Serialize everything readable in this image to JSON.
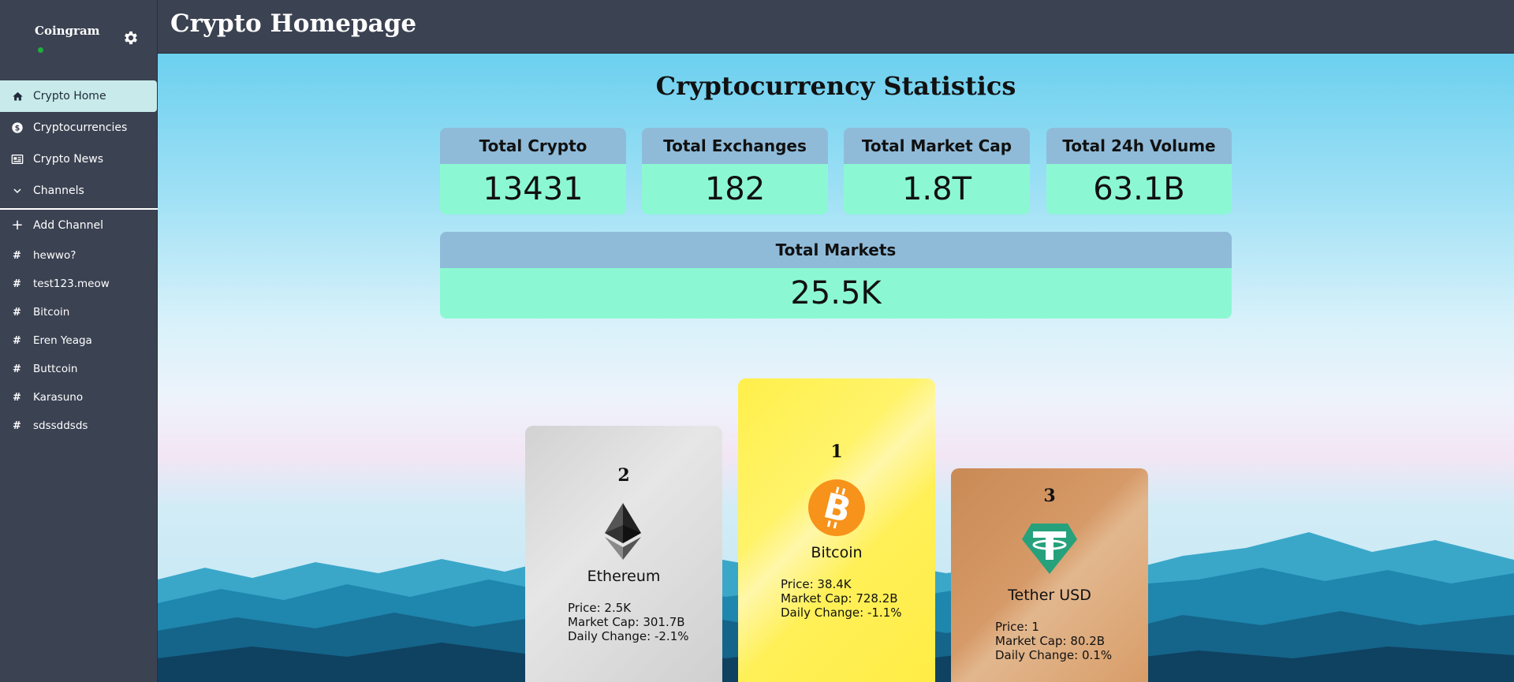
{
  "sidebar": {
    "brand": "Coingram",
    "nav": [
      {
        "label": "Crypto Home",
        "icon": "home-icon"
      },
      {
        "label": "Cryptocurrencies",
        "icon": "dollar-icon"
      },
      {
        "label": "Crypto News",
        "icon": "news-icon"
      },
      {
        "label": "Channels",
        "icon": "chevron-down-icon"
      }
    ],
    "add_channel": "Add Channel",
    "channels": [
      "hewwo?",
      "test123.meow",
      "Bitcoin",
      "Eren Yeaga",
      "Buttcoin",
      "Karasuno",
      "sdssddsds"
    ],
    "channel_symbol": "#"
  },
  "header": {
    "title": "Crypto Homepage"
  },
  "stats": {
    "title": "Cryptocurrency Statistics",
    "cards": [
      {
        "label": "Total Crypto",
        "value": "13431"
      },
      {
        "label": "Total Exchanges",
        "value": "182"
      },
      {
        "label": "Total Market Cap",
        "value": "1.8T"
      },
      {
        "label": "Total 24h Volume",
        "value": "63.1B"
      }
    ],
    "markets": {
      "label": "Total Markets",
      "value": "25.5K"
    }
  },
  "podium": {
    "first": {
      "rank": "1",
      "name": "Bitcoin",
      "price": "Price: 38.4K",
      "market_cap": "Market Cap: 728.2B",
      "change": "Daily Change: -1.1%"
    },
    "second": {
      "rank": "2",
      "name": "Ethereum",
      "price": "Price: 2.5K",
      "market_cap": "Market Cap: 301.7B",
      "change": "Daily Change: -2.1%"
    },
    "third": {
      "rank": "3",
      "name": "Tether USD",
      "price": "Price: 1",
      "market_cap": "Market Cap: 80.2B",
      "change": "Daily Change: 0.1%"
    }
  },
  "colors": {
    "sidebar_bg": "#3b4252",
    "active_nav": "#c8eaea",
    "stat_head": "#8fbbd9",
    "stat_value": "#8cf8d3",
    "bitcoin": "#f7931a",
    "tether": "#26a17b"
  }
}
